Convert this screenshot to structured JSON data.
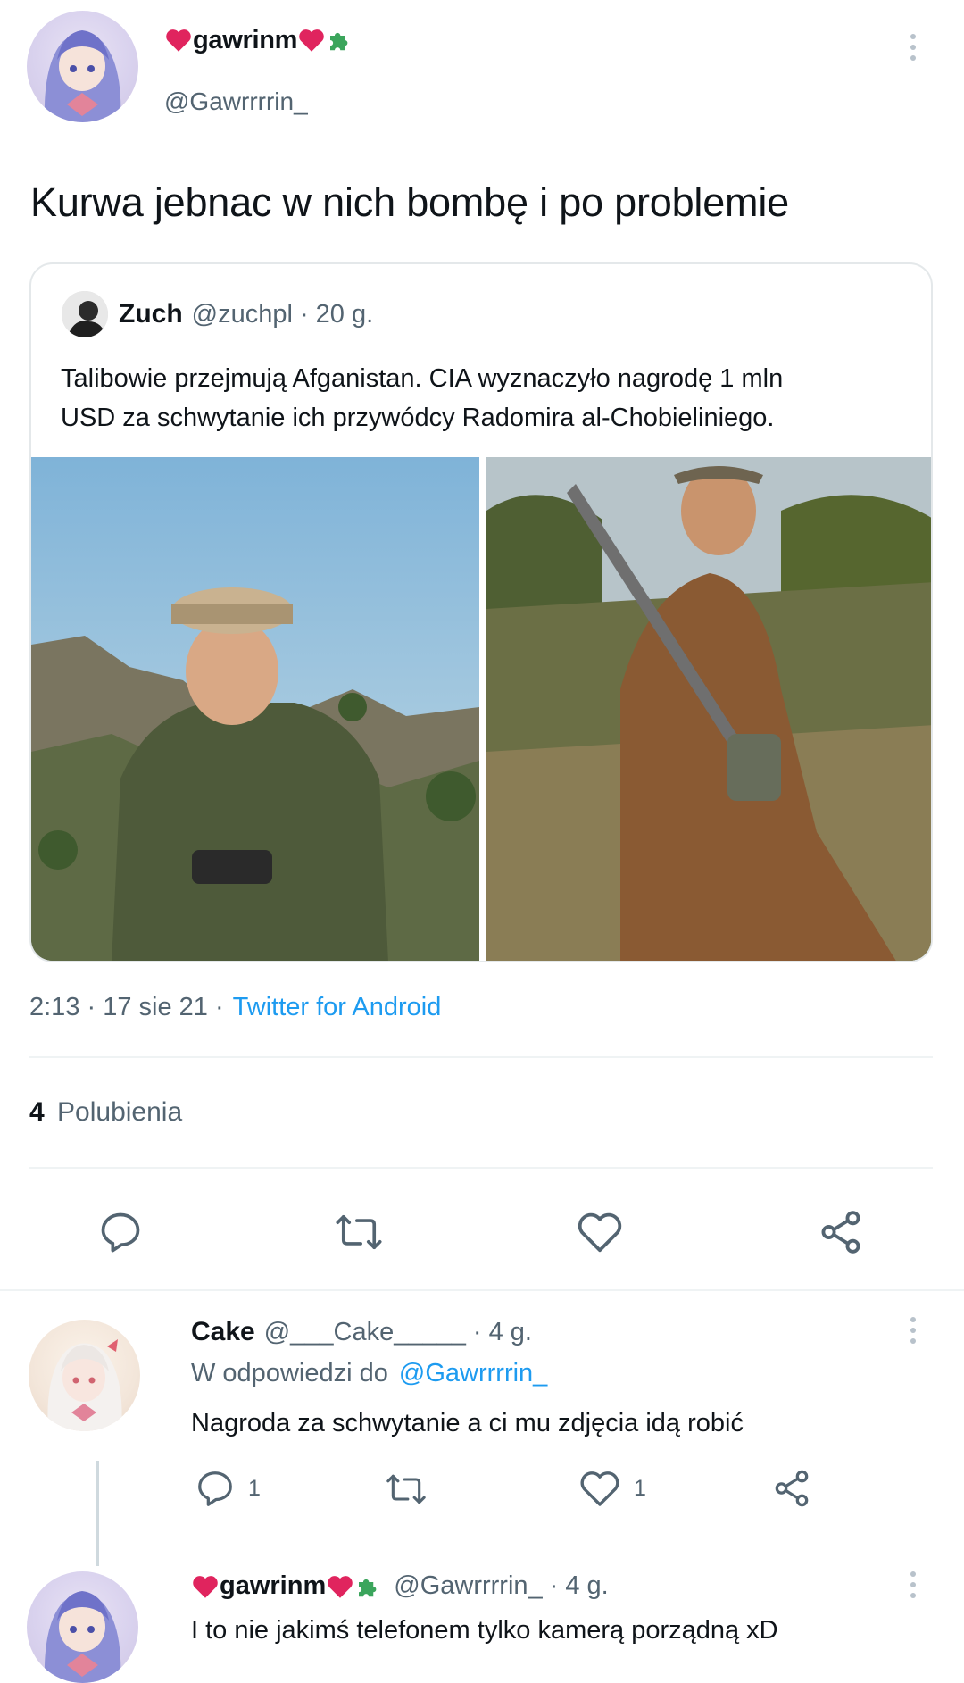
{
  "main_tweet": {
    "author_name": "gawrinm",
    "author_handle": "@Gawrrrrin_",
    "text": "Kurwa jebnac w nich bombę i po problemie",
    "timestamp": "2:13 · 17 sie 21 ·",
    "source": "Twitter for Android",
    "likes_count": "4",
    "likes_label": "Polubienia"
  },
  "quoted_tweet": {
    "author_name": "Zuch",
    "author_handle": "@zuchpl",
    "age": "· 20 g.",
    "text_line1": "Talibowie przejmują Afganistan. CIA wyznaczyło nagrodę 1 mln",
    "text_line2": "USD za schwytanie ich przywódcy Radomira al-Chobieliniego."
  },
  "reply_1": {
    "author_name": "Cake",
    "author_handle": "@___Cake_____",
    "age": "· 4 g.",
    "reply_to_prefix": "W odpowiedzi do",
    "reply_to_handle": "@Gawrrrrin_",
    "text": "Nagroda za schwytanie a ci mu zdjęcia idą robić",
    "reply_count": "1",
    "like_count": "1"
  },
  "reply_2": {
    "author_name": "gawrinm",
    "author_handle": "@Gawrrrrin_",
    "age": "· 4 g.",
    "text": "I to nie jakimś telefonem tylko kamerą porządną xD"
  },
  "colors": {
    "heart": "#e0245e",
    "puzzle": "#3ba55c",
    "link": "#1d9bf0",
    "muted": "#536471",
    "divider": "#eff3f4"
  }
}
